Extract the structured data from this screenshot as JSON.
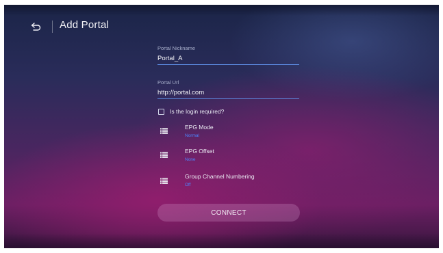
{
  "header": {
    "title": "Add Portal",
    "back_icon": "back-arrow-icon"
  },
  "form": {
    "nickname": {
      "label": "Portal Nickname",
      "value": "Portal_A"
    },
    "url": {
      "label": "Portal Url",
      "value": "http://portal.com"
    },
    "login_required": {
      "label": "Is the login required?",
      "checked": false
    }
  },
  "options": [
    {
      "title": "EPG Mode",
      "value": "Normal",
      "icon": "list-icon"
    },
    {
      "title": "EPG Offset",
      "value": "None",
      "icon": "list-icon"
    },
    {
      "title": "Group Channel Numbering",
      "value": "Off",
      "icon": "list-icon"
    }
  ],
  "connect": {
    "label": "CONNECT"
  },
  "colors": {
    "accent": "#5f8fe8",
    "value_blue": "#4c86ff",
    "background_top": "#1b2548",
    "background_bottom": "#6a1f63"
  }
}
